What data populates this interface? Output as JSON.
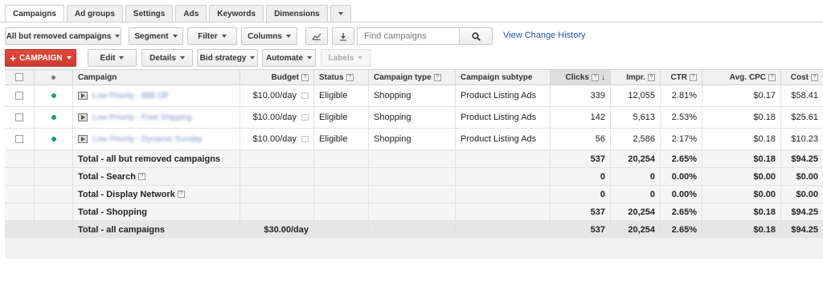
{
  "tabs": [
    {
      "label": "Campaigns"
    },
    {
      "label": "Ad groups"
    },
    {
      "label": "Settings"
    },
    {
      "label": "Ads"
    },
    {
      "label": "Keywords"
    },
    {
      "label": "Dimensions"
    }
  ],
  "toolbar1": {
    "filter_select": "All but removed campaigns",
    "segment": "Segment",
    "filter": "Filter",
    "columns": "Columns",
    "chart_icon": "line-chart-icon",
    "download_icon": "download-icon",
    "search_placeholder": "Find campaigns",
    "search_icon": "magnifier-icon",
    "history_link": "View Change History"
  },
  "toolbar2": {
    "campaign": "CAMPAIGN",
    "edit": "Edit",
    "details": "Details",
    "bid_strategy": "Bid strategy",
    "automate": "Automate",
    "labels": "Labels"
  },
  "table": {
    "headers": {
      "campaign": "Campaign",
      "budget": "Budget",
      "status": "Status",
      "campaign_type": "Campaign type",
      "campaign_subtype": "Campaign subtype",
      "clicks": "Clicks",
      "impr": "Impr.",
      "ctr": "CTR",
      "avg_cpc": "Avg. CPC",
      "cost": "Cost"
    },
    "rows": [
      {
        "campaign": "Low Priority - $$$ Off",
        "budget": "$10.00/day",
        "status": "Eligible",
        "type": "Shopping",
        "subtype": "Product Listing Ads",
        "clicks": "339",
        "impr": "12,055",
        "ctr": "2.81%",
        "cpc": "$0.17",
        "cost": "$58.41"
      },
      {
        "campaign": "Low Priority - Free Shipping",
        "budget": "$10.00/day",
        "status": "Eligible",
        "type": "Shopping",
        "subtype": "Product Listing Ads",
        "clicks": "142",
        "impr": "5,613",
        "ctr": "2.53%",
        "cpc": "$0.18",
        "cost": "$25.61"
      },
      {
        "campaign": "Low Priority - Dynamic Sunday",
        "budget": "$10.00/day",
        "status": "Eligible",
        "type": "Shopping",
        "subtype": "Product Listing Ads",
        "clicks": "56",
        "impr": "2,586",
        "ctr": "2.17%",
        "cpc": "$0.18",
        "cost": "$10.23"
      }
    ],
    "totals": [
      {
        "label": "Total - all but removed campaigns",
        "clicks": "537",
        "impr": "20,254",
        "ctr": "2.65%",
        "cpc": "$0.18",
        "cost": "$94.25"
      },
      {
        "label": "Total - Search",
        "clicks": "0",
        "impr": "0",
        "ctr": "0.00%",
        "cpc": "$0.00",
        "cost": "$0.00"
      },
      {
        "label": "Total - Display Network",
        "clicks": "0",
        "impr": "0",
        "ctr": "0.00%",
        "cpc": "$0.00",
        "cost": "$0.00"
      },
      {
        "label": "Total - Shopping",
        "clicks": "537",
        "impr": "20,254",
        "ctr": "2.65%",
        "cpc": "$0.18",
        "cost": "$94.25"
      }
    ],
    "grand_total": {
      "label": "Total - all campaigns",
      "budget": "$30.00/day",
      "clicks": "537",
      "impr": "20,254",
      "ctr": "2.65%",
      "cpc": "$0.18",
      "cost": "$94.25"
    }
  },
  "colors": {
    "accent_red": "#d8473a",
    "link_blue": "#2255b8",
    "status_green": "#1ea36a"
  }
}
